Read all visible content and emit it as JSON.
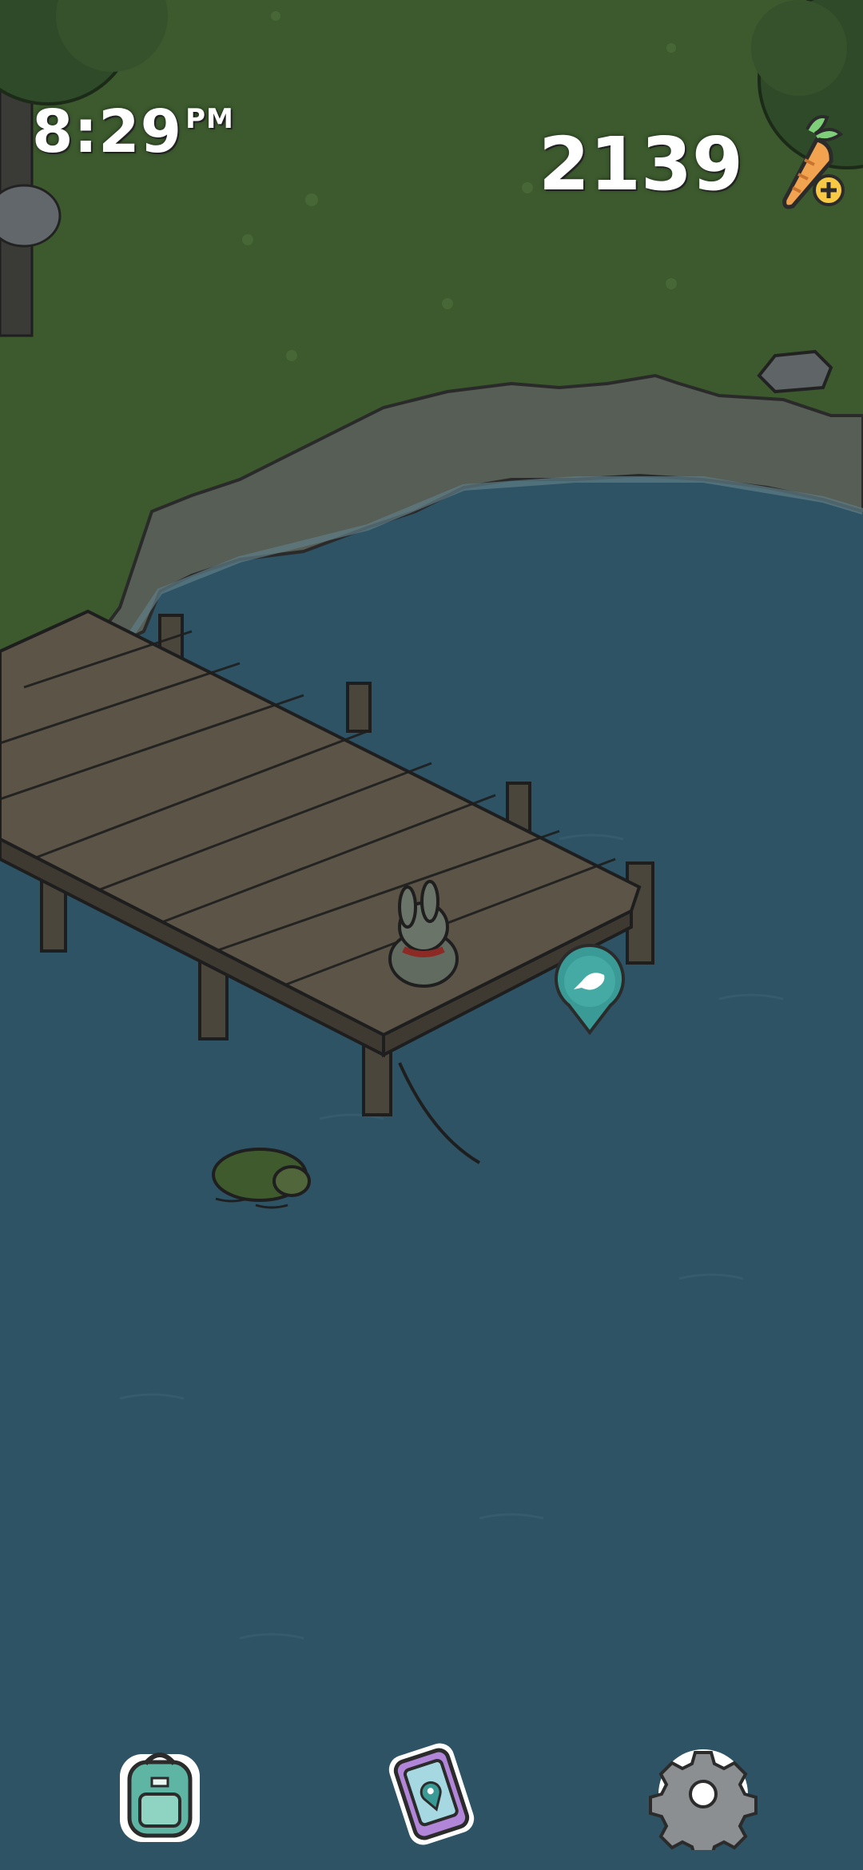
{
  "hud": {
    "time": "8:29",
    "ampm": "PM",
    "carrot_count": "2139"
  },
  "icons": {
    "carrot_add": "carrot-plus-icon",
    "fishing_spot": "fish-marker-icon",
    "backpack": "backpack-icon",
    "phone": "phone-map-icon",
    "settings": "gear-icon"
  },
  "colors": {
    "grass": "#3c5a2e",
    "water": "#2e5364",
    "dock_wood": "#5b5447",
    "marker_teal": "#3a9b96"
  }
}
